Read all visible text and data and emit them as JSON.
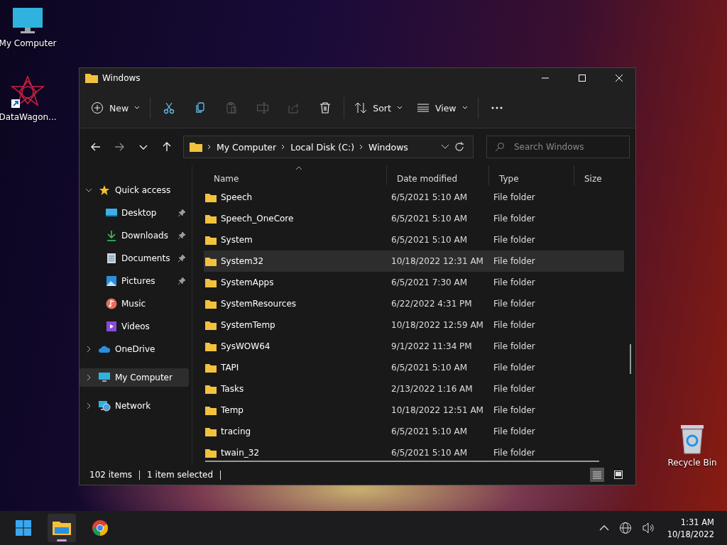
{
  "desktop_icons": [
    {
      "kind": "computer",
      "label": "My Computer"
    },
    {
      "kind": "shortcut",
      "label": "DataWagon..."
    },
    {
      "kind": "recycle",
      "label": "Recycle Bin"
    }
  ],
  "window": {
    "title": "Windows"
  },
  "toolbar": [
    {
      "kind": "new",
      "label": "New",
      "disabled": false
    },
    {
      "kind": "cut",
      "disabled": false
    },
    {
      "kind": "copy",
      "disabled": false
    },
    {
      "kind": "paste",
      "disabled": true
    },
    {
      "kind": "rename",
      "disabled": true
    },
    {
      "kind": "share",
      "disabled": true
    },
    {
      "kind": "delete",
      "disabled": false
    },
    {
      "kind": "sort",
      "label": "Sort",
      "disabled": false
    },
    {
      "kind": "view",
      "label": "View",
      "disabled": false
    },
    {
      "kind": "more",
      "disabled": false
    }
  ],
  "navigation": [
    {
      "kind": "back",
      "disabled": false
    },
    {
      "kind": "forward",
      "disabled": true
    },
    {
      "kind": "recent",
      "disabled": false
    },
    {
      "kind": "up",
      "disabled": false
    }
  ],
  "breadcrumb": [
    "My Computer",
    "Local Disk (C:)",
    "Windows"
  ],
  "search": {
    "placeholder": "Search Windows"
  },
  "sidebar": [
    {
      "kind": "star",
      "label": "Quick access",
      "expanded": true,
      "selected": false,
      "children": [
        {
          "kind": "desktop",
          "label": "Desktop",
          "pinned": true,
          "selected": false
        },
        {
          "kind": "downloads",
          "label": "Downloads",
          "pinned": true,
          "selected": false
        },
        {
          "kind": "documents",
          "label": "Documents",
          "pinned": true,
          "selected": false
        },
        {
          "kind": "pictures",
          "label": "Pictures",
          "pinned": true,
          "selected": false
        },
        {
          "kind": "music",
          "label": "Music",
          "pinned": false,
          "selected": false
        },
        {
          "kind": "videos",
          "label": "Videos",
          "pinned": false,
          "selected": false
        }
      ]
    },
    {
      "kind": "cloud",
      "label": "OneDrive",
      "expanded": false,
      "selected": false
    },
    {
      "kind": "computer",
      "label": "My Computer",
      "expanded": false,
      "selected": true
    },
    {
      "kind": "network",
      "label": "Network",
      "expanded": false,
      "selected": false
    }
  ],
  "columns": [
    {
      "label": "Name",
      "sorted": true
    },
    {
      "label": "Date modified",
      "sorted": false
    },
    {
      "label": "Type",
      "sorted": false
    },
    {
      "label": "Size",
      "sorted": false
    }
  ],
  "rows": [
    {
      "name": "Speech",
      "date": "6/5/2021 5:10 AM",
      "type": "File folder",
      "selected": false
    },
    {
      "name": "Speech_OneCore",
      "date": "6/5/2021 5:10 AM",
      "type": "File folder",
      "selected": false
    },
    {
      "name": "System",
      "date": "6/5/2021 5:10 AM",
      "type": "File folder",
      "selected": false
    },
    {
      "name": "System32",
      "date": "10/18/2022 12:31 AM",
      "type": "File folder",
      "selected": true
    },
    {
      "name": "SystemApps",
      "date": "6/5/2021 7:30 AM",
      "type": "File folder",
      "selected": false
    },
    {
      "name": "SystemResources",
      "date": "6/22/2022 4:31 PM",
      "type": "File folder",
      "selected": false
    },
    {
      "name": "SystemTemp",
      "date": "10/18/2022 12:59 AM",
      "type": "File folder",
      "selected": false
    },
    {
      "name": "SysWOW64",
      "date": "9/1/2022 11:34 PM",
      "type": "File folder",
      "selected": false
    },
    {
      "name": "TAPI",
      "date": "6/5/2021 5:10 AM",
      "type": "File folder",
      "selected": false
    },
    {
      "name": "Tasks",
      "date": "2/13/2022 1:16 AM",
      "type": "File folder",
      "selected": false
    },
    {
      "name": "Temp",
      "date": "10/18/2022 12:51 AM",
      "type": "File folder",
      "selected": false
    },
    {
      "name": "tracing",
      "date": "6/5/2021 5:10 AM",
      "type": "File folder",
      "selected": false
    },
    {
      "name": "twain_32",
      "date": "6/5/2021 5:10 AM",
      "type": "File folder",
      "selected": false
    }
  ],
  "status_bar": {
    "item_count": "102 items",
    "selection": "1 item selected"
  },
  "view_modes": [
    {
      "kind": "details",
      "selected": true
    },
    {
      "kind": "tiles",
      "selected": false
    }
  ],
  "taskbar": {
    "apps": [
      {
        "kind": "start",
        "active": false
      },
      {
        "kind": "explorer",
        "active": true
      },
      {
        "kind": "chrome",
        "active": false
      }
    ],
    "time": "1:31 AM",
    "date": "10/18/2022"
  }
}
